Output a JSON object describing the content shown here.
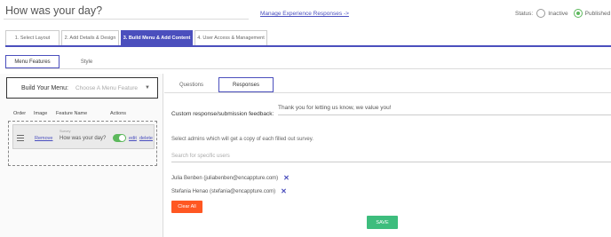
{
  "header": {
    "title": "How was your day?",
    "manage_link": "Manage Experience Responses ->",
    "status_label": "Status:",
    "status_options": [
      {
        "label": "Inactive",
        "selected": false
      },
      {
        "label": "Published",
        "selected": true
      }
    ]
  },
  "steps": [
    {
      "label": "1. Select Layout",
      "active": false
    },
    {
      "label": "2. Add Details & Design",
      "active": false
    },
    {
      "label": "3. Build Menu & Add Content",
      "active": true
    },
    {
      "label": "4. User Access & Management",
      "active": false
    }
  ],
  "subtabs": [
    {
      "label": "Menu Features",
      "active": true
    },
    {
      "label": "Style",
      "active": false
    }
  ],
  "build_menu": {
    "label": "Build Your Menu:",
    "placeholder": "Choose A Menu Feature"
  },
  "menu_table": {
    "columns": [
      "Order",
      "Image",
      "Feature Name",
      "Actions"
    ],
    "items": [
      {
        "image_link": "Remove",
        "type": "Survey",
        "name": "How was your day?",
        "toggle_on": true,
        "edit": "edit",
        "delete": "delete"
      }
    ]
  },
  "right_tabs": [
    {
      "label": "Questions",
      "active": false
    },
    {
      "label": "Responses",
      "active": true
    }
  ],
  "responses": {
    "custom_label": "Custom response/submission feedback:",
    "custom_value": "Thank you for letting us know, we value you!",
    "admins_label": "Select admins which will get a copy of each filled out survey.",
    "search_placeholder": "Search for specific users",
    "users": [
      "Julia Benben (juliabenben@encappture.com)",
      "Stefania Henao (stefania@encappture.com)"
    ],
    "clear_all": "Clear All",
    "save": "SAVE"
  },
  "colors": {
    "primary": "#4b4fbd",
    "clear_button": "#ff5722",
    "save_button": "#3dbd7d",
    "toggle_on": "#5cb85c"
  }
}
